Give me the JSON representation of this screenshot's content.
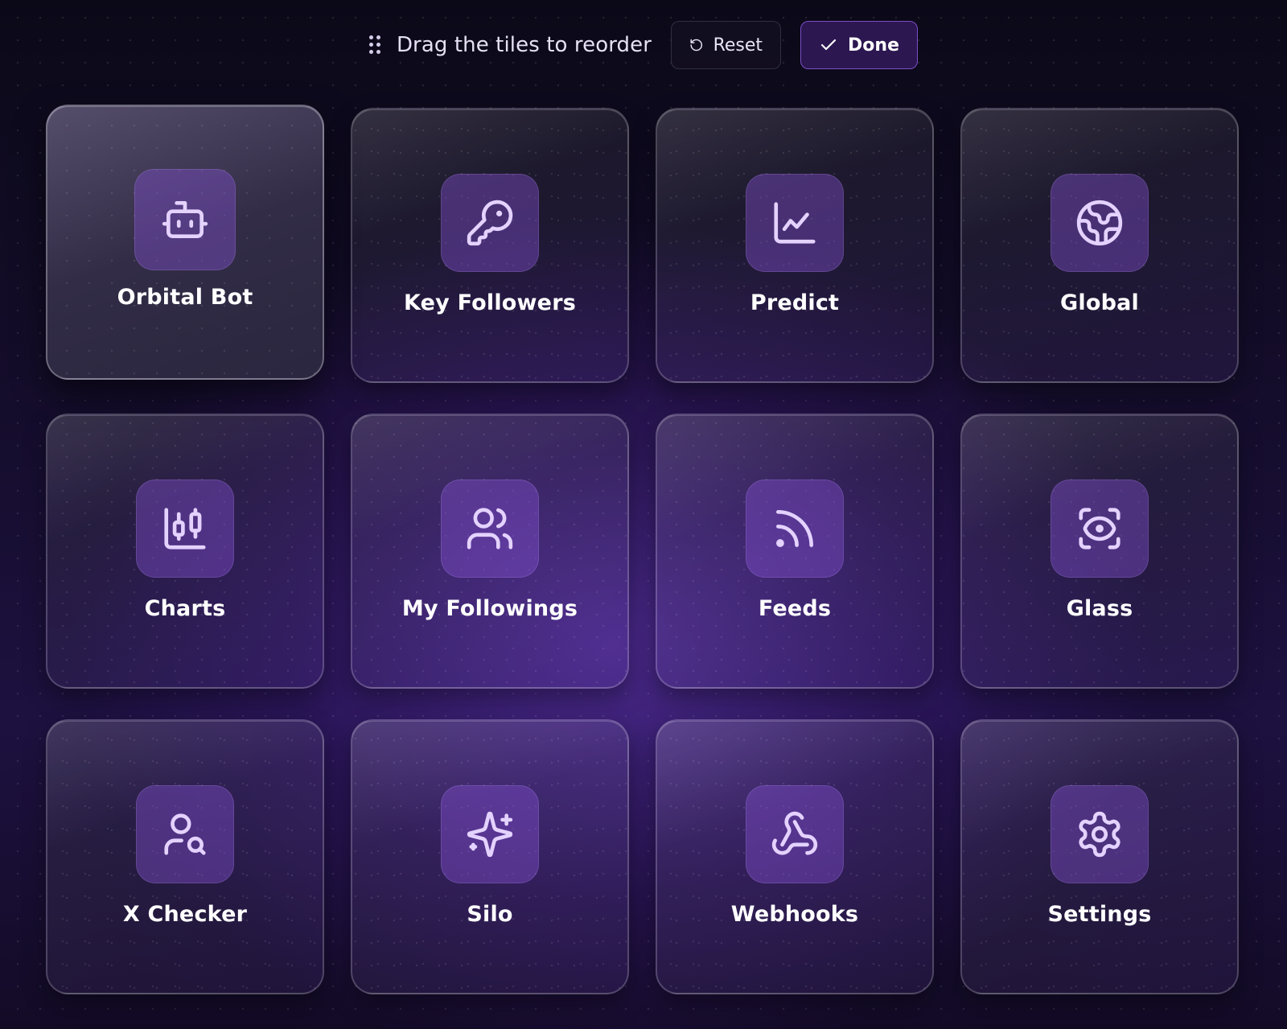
{
  "toolbar": {
    "hint_icon": "drag-grip-icon",
    "hint_text": "Drag the tiles to reorder",
    "reset_icon": "rotate-ccw-icon",
    "reset_label": "Reset",
    "done_icon": "check-icon",
    "done_label": "Done"
  },
  "colors": {
    "accent": "#7a4fc4",
    "icon_stroke": "#e4d2ff",
    "icon_tile_bg": "#5c3a99"
  },
  "tiles": [
    {
      "label": "Orbital Bot",
      "icon": "bot-icon"
    },
    {
      "label": "Key Followers",
      "icon": "key-icon"
    },
    {
      "label": "Predict",
      "icon": "line-chart-icon"
    },
    {
      "label": "Global",
      "icon": "globe-icon"
    },
    {
      "label": "Charts",
      "icon": "candlestick-chart-icon"
    },
    {
      "label": "My Followings",
      "icon": "users-icon"
    },
    {
      "label": "Feeds",
      "icon": "rss-icon"
    },
    {
      "label": "Glass",
      "icon": "scan-eye-icon"
    },
    {
      "label": "X Checker",
      "icon": "user-search-icon"
    },
    {
      "label": "Silo",
      "icon": "sparkles-icon"
    },
    {
      "label": "Webhooks",
      "icon": "webhook-icon"
    },
    {
      "label": "Settings",
      "icon": "settings-icon"
    }
  ]
}
